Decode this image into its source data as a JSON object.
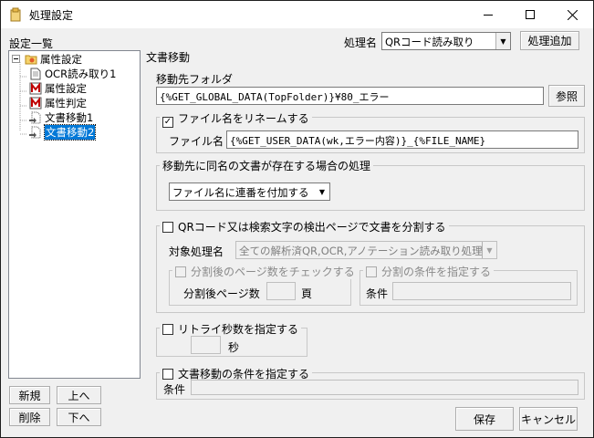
{
  "window": {
    "title": "処理設定"
  },
  "settings_list": {
    "label": "設定一覧",
    "tree": [
      {
        "label": "属性設定",
        "level": 0,
        "icon": "folder-icon"
      },
      {
        "label": "OCR読み取り1",
        "level": 1,
        "icon": "document-icon"
      },
      {
        "label": "属性設定",
        "level": 1,
        "icon": "red-m-icon"
      },
      {
        "label": "属性判定",
        "level": 1,
        "icon": "red-m-icon"
      },
      {
        "label": "文書移動1",
        "level": 1,
        "icon": "dotted-document-icon"
      },
      {
        "label": "文書移動2",
        "level": 1,
        "icon": "dotted-document-icon",
        "selected": true
      }
    ],
    "buttons": {
      "new": "新規",
      "up": "上へ",
      "delete": "削除",
      "down": "下へ"
    }
  },
  "header": {
    "process_name_label": "処理名",
    "process_name_value": "QRコード読み取り",
    "add_process_button": "処理追加"
  },
  "main": {
    "section_title": "文書移動",
    "dest_folder_label": "移動先フォルダ",
    "dest_folder_value": "{%GET_GLOBAL_DATA(TopFolder)}¥80_エラー",
    "browse_button": "参照",
    "rename_group": {
      "legend": "ファイル名をリネームする",
      "checked": true,
      "filename_label": "ファイル名",
      "filename_value": "{%GET_USER_DATA(wk,エラー内容)}_{%FILE_NAME}"
    },
    "duplicate_group": {
      "legend": "移動先に同名の文書が存在する場合の処理",
      "option_value": "ファイル名に連番を付加する"
    },
    "split_group": {
      "legend": "QRコード又は検索文字の検出ページで文書を分割する",
      "checked": false,
      "target_label": "対象処理名",
      "target_value": "全ての解析済QR,OCR,アノテーション読み取り処理",
      "page_check": {
        "legend": "分割後のページ数をチェックする",
        "pages_label": "分割後ページ数",
        "unit": "頁"
      },
      "condition": {
        "legend": "分割の条件を指定する",
        "label": "条件"
      }
    },
    "retry_group": {
      "legend": "リトライ秒数を指定する",
      "checked": false,
      "unit": "秒"
    },
    "move_condition_group": {
      "legend": "文書移動の条件を指定する",
      "checked": false,
      "label": "条件"
    }
  },
  "footer": {
    "save": "保存",
    "cancel": "キャンセル"
  }
}
